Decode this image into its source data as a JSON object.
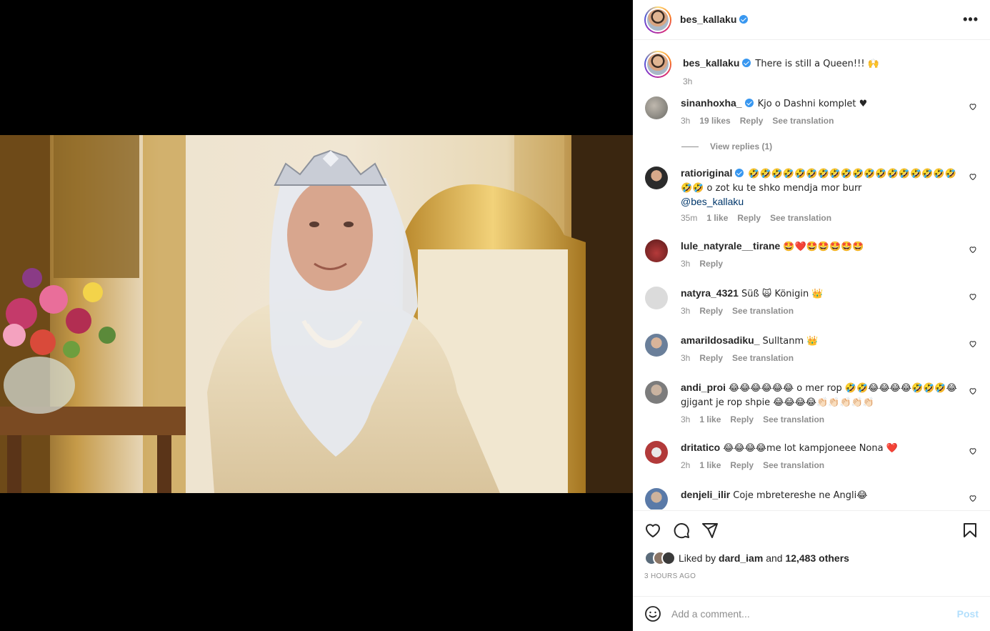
{
  "post": {
    "username": "bes_kallaku",
    "caption": "There is still a Queen!!! 🙌",
    "caption_time": "3h"
  },
  "comments": [
    {
      "user": "sinanhoxha_",
      "verified": true,
      "text": "Kjo o Dashni komplet ♥",
      "time": "3h",
      "likes": "19 likes",
      "reply": "Reply",
      "translate": "See translation",
      "avatar_color": "#6b6b66"
    },
    {
      "user": "ratioriginal",
      "verified": true,
      "text": "🤣🤣🤣🤣🤣🤣🤣🤣🤣🤣🤣🤣🤣🤣🤣🤣🤣🤣🤣🤣 o zot ku te shko mendja mor burr",
      "mention": "@bes_kallaku",
      "time": "35m",
      "likes": "1 like",
      "reply": "Reply",
      "translate": "See translation",
      "avatar_color": "#2b2b2b"
    },
    {
      "user": "lule_natyrale__tirane",
      "verified": false,
      "text": "🤩❤️🤩🤩🤩🤩🤩",
      "time": "3h",
      "likes": "",
      "reply": "Reply",
      "translate": "",
      "avatar_color": "#8a2b2b"
    },
    {
      "user": "natyra_4321",
      "verified": false,
      "text": "Süß 🙀 Königin 👑",
      "time": "3h",
      "likes": "",
      "reply": "Reply",
      "translate": "See translation",
      "avatar_color": "#dbdbdb"
    },
    {
      "user": "amarildosadiku_",
      "verified": false,
      "text": "Sulltanm 👑",
      "time": "3h",
      "likes": "",
      "reply": "Reply",
      "translate": "See translation",
      "avatar_color": "#6a7f9a"
    },
    {
      "user": "andi_proi",
      "verified": false,
      "text": "😂😂😂😂😂😂 o mer rop 🤣🤣😂😂😂😂🤣🤣🤣😂gjigant je rop shpie 😂😂😂😂👏🏻👏🏻👏🏻👏🏻👏🏻",
      "time": "3h",
      "likes": "1 like",
      "reply": "Reply",
      "translate": "See translation",
      "avatar_color": "#7c7c7c"
    },
    {
      "user": "dritatico",
      "verified": false,
      "text": "😂😂😂😂me lot kampjoneee Nona ❤️",
      "time": "2h",
      "likes": "1 like",
      "reply": "Reply",
      "translate": "See translation",
      "avatar_color": "#b23a3a"
    },
    {
      "user": "denjeli_ilir",
      "verified": false,
      "text": "Coje mbretereshe ne Angli😂",
      "time": "",
      "likes": "",
      "reply": "",
      "translate": "",
      "avatar_color": "#5a7aa8"
    }
  ],
  "view_replies": "View replies (1)",
  "likes_summary": {
    "prefix": "Liked by",
    "first_liker": "dard_iam",
    "conj": "and",
    "others": "12,483 others"
  },
  "timestamp": "3 HOURS AGO",
  "add_comment": {
    "placeholder": "Add a comment...",
    "post_label": "Post"
  },
  "colors": {
    "verified": "#3897f0",
    "heart_red": "#ed4956",
    "post_disabled": "#b2dffc"
  },
  "icons": [
    "more-icon",
    "heart-icon",
    "comment-icon",
    "share-icon",
    "save-icon",
    "emoji-icon",
    "small-heart-icon",
    "verified-badge-icon"
  ]
}
